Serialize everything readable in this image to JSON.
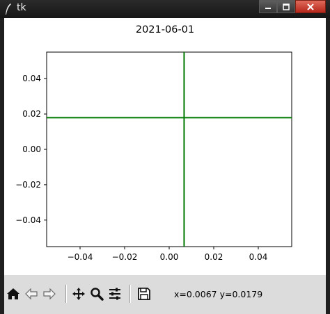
{
  "window": {
    "title": "tk",
    "buttons": [
      "minimize-button",
      "maximize-button",
      "close-button"
    ]
  },
  "plot": {
    "title": "2021-06-01",
    "crosshair_color": "#007a00"
  },
  "chart_data": {
    "type": "line",
    "title": "2021-06-01",
    "xlabel": "",
    "ylabel": "",
    "xlim": [
      -0.055,
      0.055
    ],
    "ylim": [
      -0.055,
      0.055
    ],
    "x_ticks": [
      -0.04,
      -0.02,
      0.0,
      0.02,
      0.04
    ],
    "y_ticks": [
      -0.04,
      -0.02,
      0.0,
      0.02,
      0.04
    ],
    "x_tick_labels": [
      "−0.04",
      "−0.02",
      "0.00",
      "0.02",
      "0.04"
    ],
    "y_tick_labels": [
      "−0.04",
      "−0.02",
      "0.00",
      "0.02",
      "0.04"
    ],
    "grid": false,
    "series": [
      {
        "kind": "vertical_line",
        "x": 0.0067,
        "color": "#007a00"
      },
      {
        "kind": "horizontal_line",
        "y": 0.0179,
        "color": "#007a00"
      }
    ]
  },
  "toolbar": {
    "buttons": [
      {
        "name": "home-button",
        "icon": "home-icon"
      },
      {
        "name": "back-button",
        "icon": "arrow-left-icon"
      },
      {
        "name": "forward-button",
        "icon": "arrow-right-icon"
      },
      {
        "name": "pan-button",
        "icon": "move-icon"
      },
      {
        "name": "zoom-button",
        "icon": "magnifier-icon"
      },
      {
        "name": "configure-subplots-button",
        "icon": "sliders-icon"
      },
      {
        "name": "save-button",
        "icon": "floppy-disk-icon"
      }
    ],
    "coordinates": "x=0.0067 y=0.0179"
  }
}
